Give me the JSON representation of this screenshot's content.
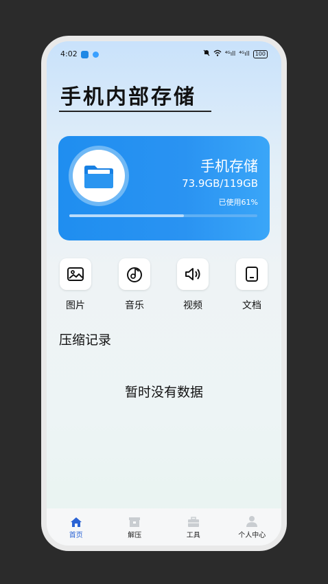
{
  "status_bar": {
    "time": "4:02",
    "signal_1": "⁴ᴳıll",
    "signal_2": "⁴ᴳıll",
    "battery": "100"
  },
  "page_title": "手机内部存储",
  "storage": {
    "name": "手机存储",
    "size": "73.9GB/119GB",
    "used_label": "已使用61%",
    "used_fraction": 0.61
  },
  "categories": [
    {
      "label": "图片",
      "icon": "image-icon"
    },
    {
      "label": "音乐",
      "icon": "music-disc-icon"
    },
    {
      "label": "视频",
      "icon": "speaker-icon"
    },
    {
      "label": "文档",
      "icon": "document-icon"
    }
  ],
  "compress_section": {
    "title": "压缩记录",
    "empty_text": "暂时没有数据"
  },
  "bottom_nav": [
    {
      "label": "首页",
      "icon": "home-icon",
      "active": true
    },
    {
      "label": "解压",
      "icon": "box-icon",
      "active": false
    },
    {
      "label": "工具",
      "icon": "toolbox-icon",
      "active": false
    },
    {
      "label": "个人中心",
      "icon": "person-icon",
      "active": false
    }
  ],
  "colors": {
    "accent": "#2a63d4",
    "card": "#1f8ef0",
    "folder": "#1f8ef0"
  }
}
